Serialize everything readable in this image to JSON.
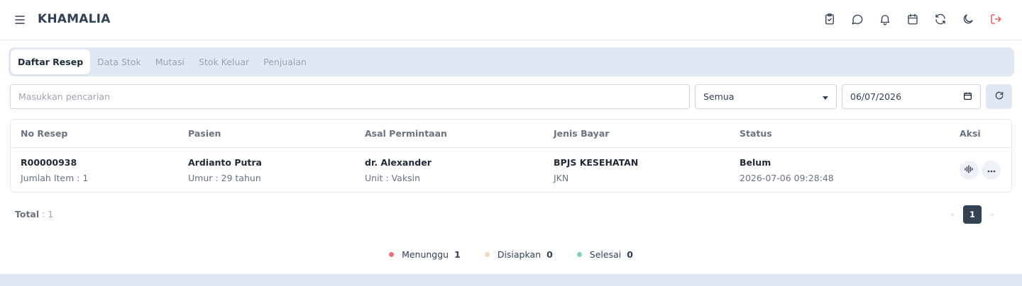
{
  "app": {
    "title": "KHAMALIA"
  },
  "header": {
    "icons": [
      "clipboard-check-icon",
      "chat-icon",
      "bell-icon",
      "calendar-icon",
      "refresh-icon",
      "moon-icon",
      "logout-icon"
    ]
  },
  "tabs": [
    {
      "label": "Daftar Resep",
      "active": true
    },
    {
      "label": "Data Stok",
      "active": false
    },
    {
      "label": "Mutasi",
      "active": false
    },
    {
      "label": "Stok Keluar",
      "active": false
    },
    {
      "label": "Penjualan",
      "active": false
    }
  ],
  "filters": {
    "search_placeholder": "Masukkan pencarian",
    "search_value": "",
    "status_select": "Semua",
    "date": "06/07/2026"
  },
  "table": {
    "columns": [
      "No Resep",
      "Pasien",
      "Asal Permintaan",
      "Jenis Bayar",
      "Status",
      "Aksi"
    ],
    "rows": [
      {
        "no_resep": "R00000938",
        "jumlah_item": "Jumlah Item : 1",
        "pasien": "Ardianto Putra",
        "umur": "Umur : 29 tahun",
        "asal": "dr. Alexander",
        "unit": "Unit : Vaksin",
        "jenis_bayar": "BPJS KESEHATAN",
        "jenis_bayar_sub": "JKN",
        "status": "Belum",
        "status_time": "2026-07-06 09:28:48"
      }
    ]
  },
  "footer": {
    "total_label": "Total",
    "total_value": ": 1",
    "page_current": "1",
    "prev": "«",
    "next": "»"
  },
  "legend": [
    {
      "label": "Menunggu",
      "count": "1",
      "color": "#e57373"
    },
    {
      "label": "Disiapkan",
      "count": "0",
      "color": "#f5d6b8"
    },
    {
      "label": "Selesai",
      "count": "0",
      "color": "#80cbc4"
    }
  ],
  "colors": {
    "accent": "#334155",
    "logout": "#ef4444",
    "tabbar_bg": "#e2e8f3"
  }
}
